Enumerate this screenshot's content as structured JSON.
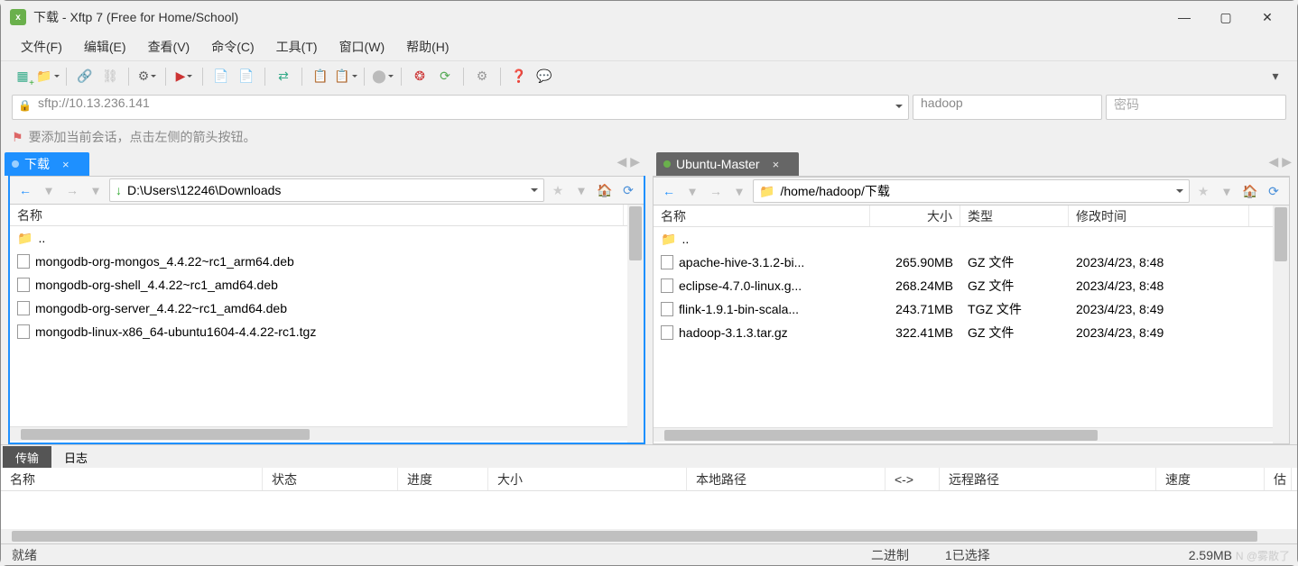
{
  "window": {
    "title": "下载 - Xftp 7 (Free for Home/School)"
  },
  "menus": [
    "文件(F)",
    "编辑(E)",
    "查看(V)",
    "命令(C)",
    "工具(T)",
    "窗口(W)",
    "帮助(H)"
  ],
  "addr": {
    "url": "sftp://10.13.236.141",
    "user": "hadoop",
    "pw_placeholder": "密码"
  },
  "hint": "要添加当前会话，点击左侧的箭头按钮。",
  "left": {
    "tab": "下载",
    "path": "D:\\Users\\12246\\Downloads",
    "columns": [
      "名称"
    ],
    "parent": "..",
    "files": [
      {
        "name": "mongodb-org-mongos_4.4.22~rc1_arm64.deb"
      },
      {
        "name": "mongodb-org-shell_4.4.22~rc1_amd64.deb"
      },
      {
        "name": "mongodb-org-server_4.4.22~rc1_amd64.deb"
      },
      {
        "name": "mongodb-linux-x86_64-ubuntu1604-4.4.22-rc1.tgz"
      }
    ]
  },
  "right": {
    "tab": "Ubuntu-Master",
    "path": "/home/hadoop/下载",
    "columns": [
      "名称",
      "大小",
      "类型",
      "修改时间"
    ],
    "parent": "..",
    "files": [
      {
        "name": "apache-hive-3.1.2-bi...",
        "size": "265.90MB",
        "type": "GZ 文件",
        "mtime": "2023/4/23, 8:48"
      },
      {
        "name": "eclipse-4.7.0-linux.g...",
        "size": "268.24MB",
        "type": "GZ 文件",
        "mtime": "2023/4/23, 8:48"
      },
      {
        "name": "flink-1.9.1-bin-scala...",
        "size": "243.71MB",
        "type": "TGZ 文件",
        "mtime": "2023/4/23, 8:49"
      },
      {
        "name": "hadoop-3.1.3.tar.gz",
        "size": "322.41MB",
        "type": "GZ 文件",
        "mtime": "2023/4/23, 8:49"
      }
    ]
  },
  "bottomTabs": [
    "传输",
    "日志"
  ],
  "transferCols": [
    "名称",
    "状态",
    "进度",
    "大小",
    "本地路径",
    "<->",
    "远程路径",
    "速度",
    "估"
  ],
  "status": {
    "ready": "就绪",
    "mode": "二进制",
    "selected": "1已选择",
    "size": "2.59MB"
  },
  "watermark": "N @雾散了"
}
